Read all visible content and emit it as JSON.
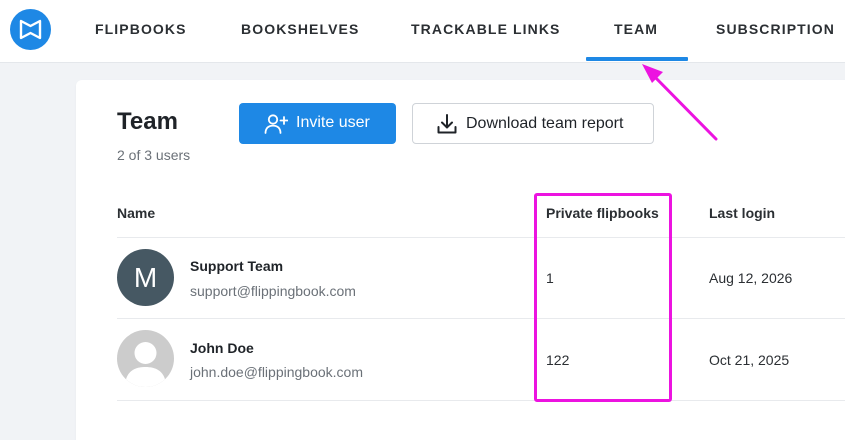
{
  "nav": {
    "tabs": [
      {
        "label": "FLIPBOOKS"
      },
      {
        "label": "BOOKSHELVES"
      },
      {
        "label": "TRACKABLE LINKS"
      },
      {
        "label": "TEAM",
        "active": true
      },
      {
        "label": "SUBSCRIPTION"
      }
    ],
    "logo_icon": "flippingbook-logo-icon"
  },
  "page": {
    "title": "Team",
    "user_count": "2 of 3 users",
    "invite_button": {
      "label": "Invite user",
      "icon": "add-user-icon"
    },
    "download_button": {
      "label": "Download team report",
      "icon": "download-icon"
    }
  },
  "table": {
    "columns": [
      "Name",
      "Private flipbooks",
      "Last login"
    ],
    "rows": [
      {
        "avatar": "M",
        "name": "Support Team",
        "email": "support@flippingbook.com",
        "private_flipbooks": "1",
        "last_login": "Aug 12, 2026"
      },
      {
        "avatar": "",
        "name": "John Doe",
        "email": "john.doe@flippingbook.com",
        "private_flipbooks": "122",
        "last_login": "Oct 21, 2025"
      }
    ]
  },
  "colors": {
    "accent": "#1e88e5",
    "annotation": "#ec13e0",
    "avatar_dark": "#465863"
  }
}
